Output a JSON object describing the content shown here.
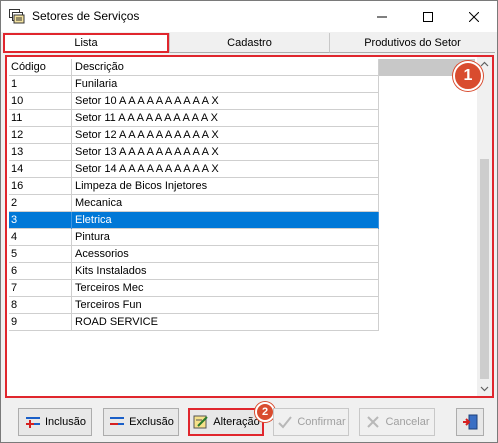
{
  "window": {
    "title": "Setores de Serviços"
  },
  "tabs": [
    {
      "label": "Lista"
    },
    {
      "label": "Cadastro"
    },
    {
      "label": "Produtivos do Setor"
    }
  ],
  "grid": {
    "columns": [
      "Código",
      "Descrição"
    ],
    "rows": [
      [
        "1",
        "Funilaria"
      ],
      [
        "10",
        "Setor 10 A A A A A A A A A A X"
      ],
      [
        "11",
        "Setor 11 A A A A A A A A A A X"
      ],
      [
        "12",
        "Setor 12 A A A A A A A A A A X"
      ],
      [
        "13",
        "Setor 13 A A A A A A A A A A X"
      ],
      [
        "14",
        "Setor 14 A A A A A A A A A A X"
      ],
      [
        "16",
        "Limpeza de Bicos Injetores"
      ],
      [
        "2",
        "Mecanica"
      ],
      [
        "3",
        "Eletrica"
      ],
      [
        "4",
        "Pintura"
      ],
      [
        "5",
        "Acessorios"
      ],
      [
        "6",
        "Kits Instalados"
      ],
      [
        "7",
        "Terceiros Mec"
      ],
      [
        "8",
        "Terceiros Fun"
      ],
      [
        "9",
        "ROAD SERVICE"
      ]
    ],
    "selected_code": "3"
  },
  "badges": {
    "grid": "1",
    "alteracao": "2"
  },
  "buttons": {
    "inclusao": "Inclusão",
    "exclusao": "Exclusão",
    "alteracao": "Alteração",
    "confirmar": "Confirmar",
    "cancelar": "Cancelar"
  },
  "colors": {
    "selection": "#0078d7",
    "highlight": "#e0262d",
    "badge": "#d94c2f"
  }
}
